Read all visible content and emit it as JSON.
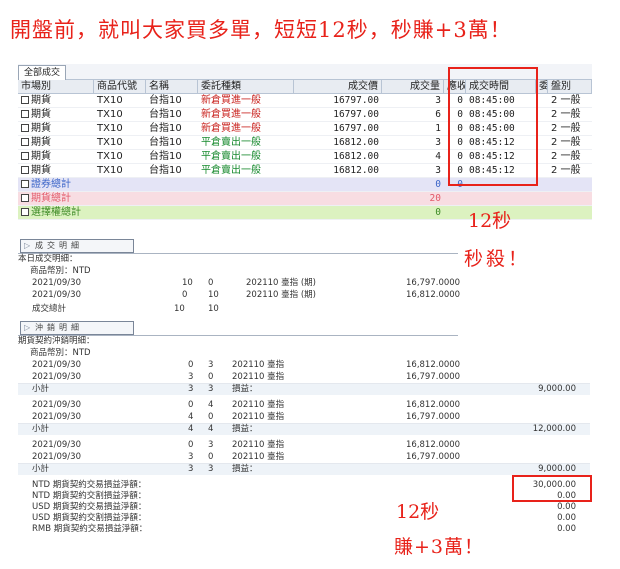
{
  "headline": "開盤前，就叫大家買多單，短短12秒，秒賺+3萬！",
  "tab_label": "全部成交",
  "columns": [
    "市場別",
    "商品代號",
    "名稱",
    "委託種類",
    "成交價",
    "成交量",
    "應收...",
    "成交時間",
    "委",
    "盤別"
  ],
  "rows": [
    {
      "market": "期貨",
      "code": "TX10",
      "name": "台指10",
      "type": "新倉買進一般",
      "price": "16797.00",
      "qty": "3",
      "recv": "0",
      "time": "08:45:00",
      "session": "2 一般",
      "color": "#c8201c"
    },
    {
      "market": "期貨",
      "code": "TX10",
      "name": "台指10",
      "type": "新倉買進一般",
      "price": "16797.00",
      "qty": "6",
      "recv": "0",
      "time": "08:45:00",
      "session": "2 一般",
      "color": "#c8201c"
    },
    {
      "market": "期貨",
      "code": "TX10",
      "name": "台指10",
      "type": "新倉買進一般",
      "price": "16797.00",
      "qty": "1",
      "recv": "0",
      "time": "08:45:00",
      "session": "2 一般",
      "color": "#c8201c"
    },
    {
      "market": "期貨",
      "code": "TX10",
      "name": "台指10",
      "type": "平倉賣出一般",
      "price": "16812.00",
      "qty": "3",
      "recv": "0",
      "time": "08:45:12",
      "session": "2 一般",
      "color": "#178a2e"
    },
    {
      "market": "期貨",
      "code": "TX10",
      "name": "台指10",
      "type": "平倉賣出一般",
      "price": "16812.00",
      "qty": "4",
      "recv": "0",
      "time": "08:45:12",
      "session": "2 一般",
      "color": "#178a2e"
    },
    {
      "market": "期貨",
      "code": "TX10",
      "name": "台指10",
      "type": "平倉賣出一般",
      "price": "16812.00",
      "qty": "3",
      "recv": "0",
      "time": "08:45:12",
      "session": "2 一般",
      "color": "#178a2e"
    }
  ],
  "summaries": {
    "stock": {
      "label": "證券總計",
      "qty": "0",
      "recv": "0"
    },
    "futures": {
      "label": "期貨總計",
      "qty": "20"
    },
    "options": {
      "label": "選擇權總計",
      "qty": "0"
    }
  },
  "trade_section": {
    "tab": "成交明細",
    "title": "本日成交明細：",
    "currency": "商品幣別：NTD",
    "rows": [
      {
        "date": "2021/09/30",
        "buy": "10",
        "sell": "0",
        "item": "202110 臺指 (期)",
        "price": "16,797.0000"
      },
      {
        "date": "2021/09/30",
        "buy": "0",
        "sell": "10",
        "item": "202110 臺指 (期)",
        "price": "16,812.0000"
      }
    ],
    "total_label": "成交總計",
    "total_buy": "10",
    "total_sell": "10"
  },
  "offset_section": {
    "tab": "沖銷明細",
    "title": "期貨契約沖銷明細：",
    "currency": "商品幣別：NTD",
    "groups": [
      {
        "rows": [
          {
            "date": "2021/09/30",
            "a": "0",
            "b": "3",
            "item": "202110 臺指",
            "price": "16,812.0000"
          },
          {
            "date": "2021/09/30",
            "a": "3",
            "b": "0",
            "item": "202110 臺指",
            "price": "16,797.0000"
          }
        ],
        "subtotal": {
          "label": "小計",
          "a": "3",
          "b": "3",
          "pl_label": "損益：",
          "pl": "9,000.00"
        }
      },
      {
        "rows": [
          {
            "date": "2021/09/30",
            "a": "0",
            "b": "4",
            "item": "202110 臺指",
            "price": "16,812.0000"
          },
          {
            "date": "2021/09/30",
            "a": "4",
            "b": "0",
            "item": "202110 臺指",
            "price": "16,797.0000"
          }
        ],
        "subtotal": {
          "label": "小計",
          "a": "4",
          "b": "4",
          "pl_label": "損益：",
          "pl": "12,000.00"
        }
      },
      {
        "rows": [
          {
            "date": "2021/09/30",
            "a": "0",
            "b": "3",
            "item": "202110 臺指",
            "price": "16,812.0000"
          },
          {
            "date": "2021/09/30",
            "a": "3",
            "b": "0",
            "item": "202110 臺指",
            "price": "16,797.0000"
          }
        ],
        "subtotal": {
          "label": "小計",
          "a": "3",
          "b": "3",
          "pl_label": "損益：",
          "pl": "9,000.00"
        }
      }
    ],
    "pl_summary": [
      {
        "label": "NTD 期貨契約交易損益淨額：",
        "value": "30,000.00"
      },
      {
        "label": "NTD 期貨契約交割損益淨額：",
        "value": "0.00"
      },
      {
        "label": "USD 期貨契約交易損益淨額：",
        "value": "0.00"
      },
      {
        "label": "USD 期貨契約交割損益淨額：",
        "value": "0.00"
      },
      {
        "label": "RMB 期貨契約交易損益淨額：",
        "value": "0.00"
      }
    ]
  },
  "annotations": {
    "top_line1": "12秒",
    "top_line2": "秒殺！",
    "bottom_line1": "12秒",
    "bottom_line2": "賺+3萬！"
  }
}
